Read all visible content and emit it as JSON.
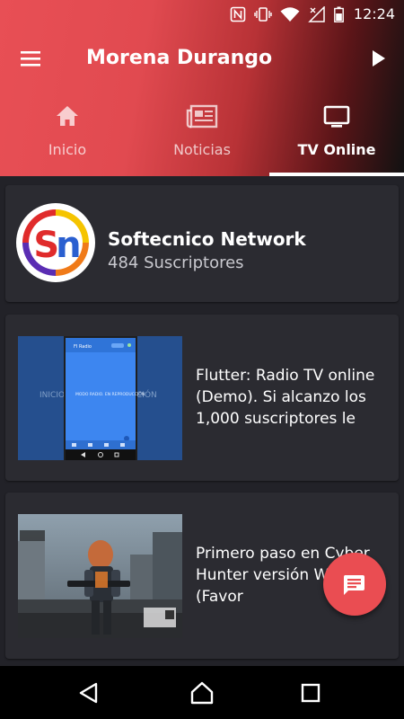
{
  "status_bar": {
    "time": "12:24"
  },
  "app_bar": {
    "title": "Morena Durango",
    "menu_icon": "hamburger-menu-icon",
    "play_icon": "play-icon"
  },
  "tabs": [
    {
      "label": "Inicio",
      "icon": "home-icon",
      "active": false
    },
    {
      "label": "Noticias",
      "icon": "newspaper-icon",
      "active": false
    },
    {
      "label": "TV Online",
      "icon": "tv-icon",
      "active": true
    }
  ],
  "channel": {
    "name": "Softecnico Network",
    "subscribers": "484 Suscriptores",
    "logo_letters": "Sn"
  },
  "videos": [
    {
      "title": "Flutter: Radio TV online (Demo). Si alcanzo los 1,000  suscriptores le",
      "thumbnail": {
        "app_title": "FI Radio",
        "side_left": "INICIO",
        "side_right": "CIÓN",
        "center_text": "MODO RADIO. EN REPRODUCCIÓN"
      }
    },
    {
      "title": "Primero paso en Cyber Hunter versión Windows (Favor"
    }
  ],
  "fab": {
    "icon": "chat-message-icon"
  },
  "colors": {
    "accent": "#ea4d52",
    "background": "#222228",
    "card": "#2b2b31"
  }
}
